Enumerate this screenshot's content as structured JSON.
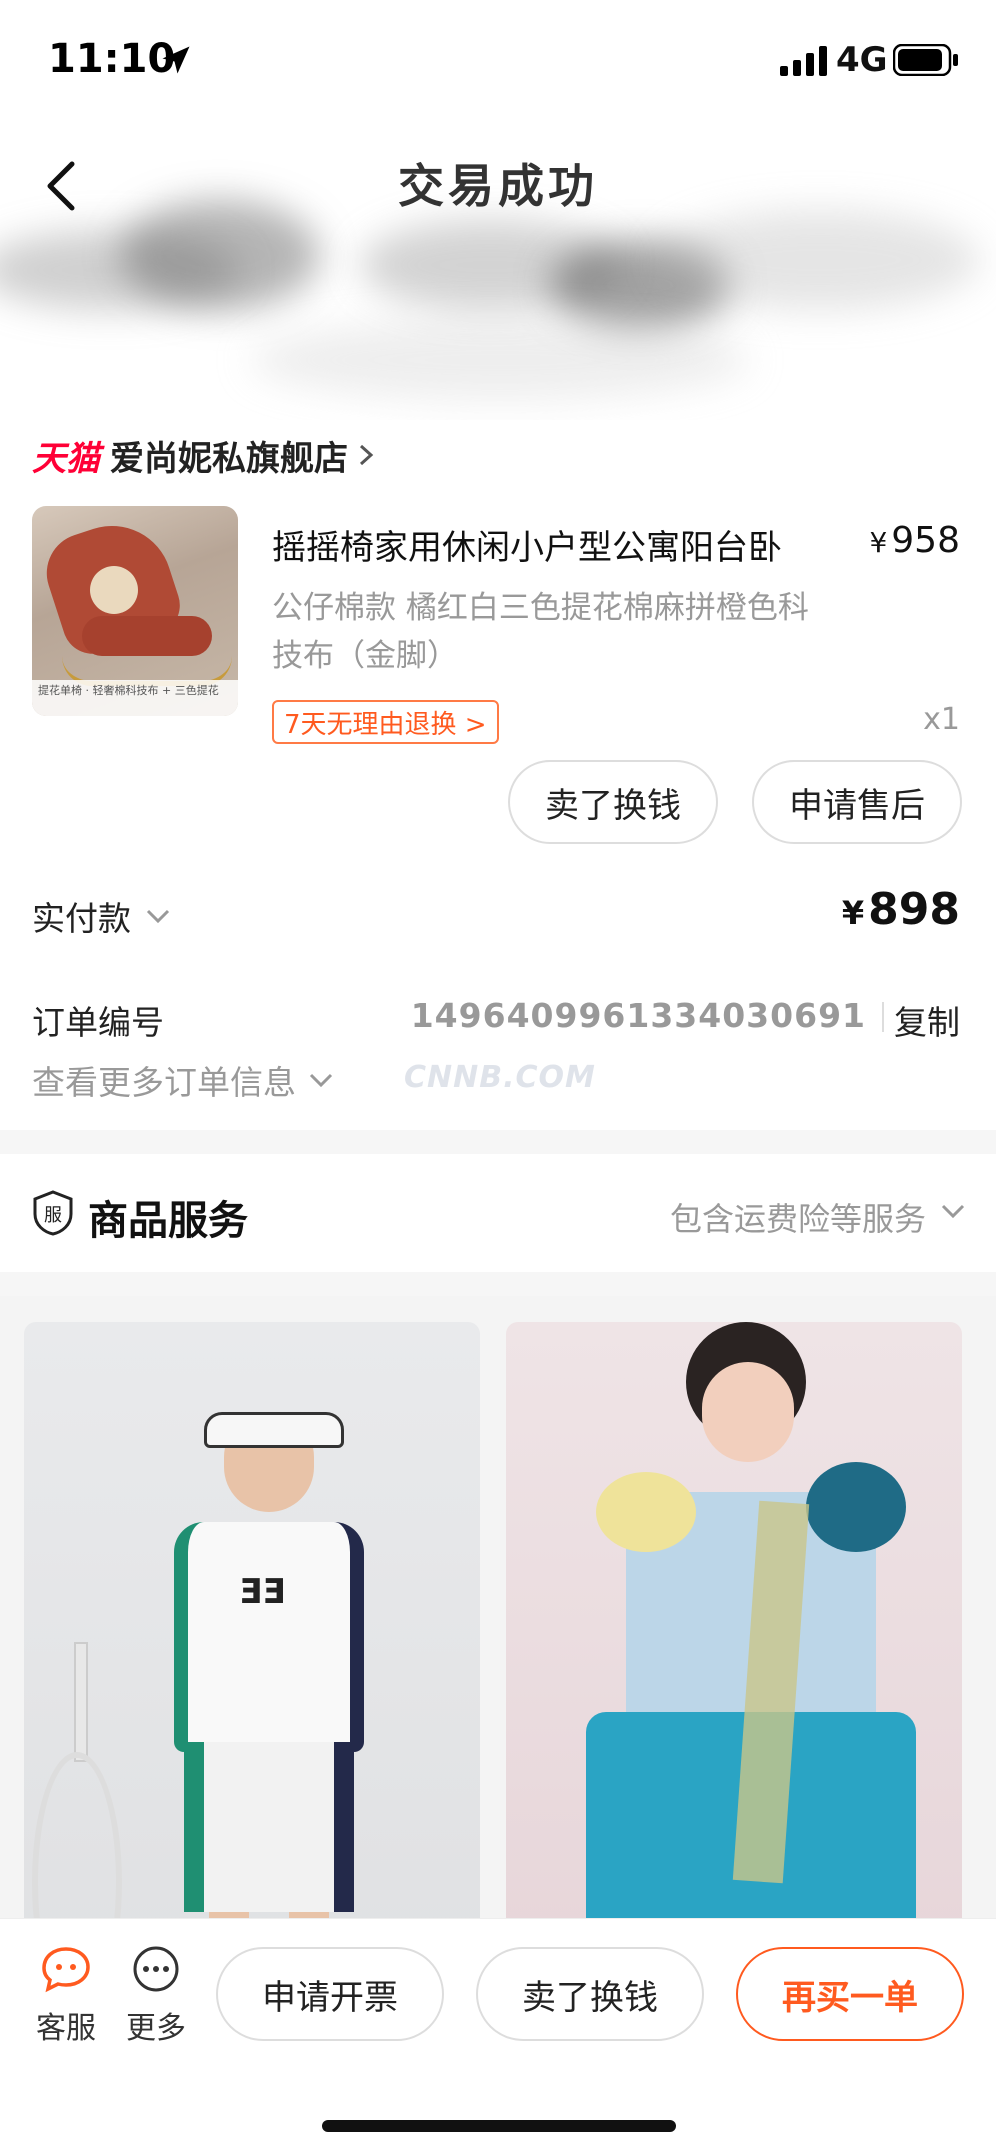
{
  "status": {
    "time": "11:10",
    "network": "4G"
  },
  "header": {
    "title": "交易成功"
  },
  "shop": {
    "platform": "天猫",
    "name": "爱尚妮私旗舰店"
  },
  "product": {
    "title": "摇摇椅家用休闲小户型公寓阳台卧",
    "price_symbol": "¥",
    "price": "958",
    "sku": "公仔棉款 橘红白三色提花棉麻拼橙色科技布（金脚）",
    "return_tag": "7天无理由退换 >",
    "quantity": "x1",
    "image_caption": "提花单椅 · 轻奢棉科技布 + 三色提花"
  },
  "actions": {
    "sell": "卖了换钱",
    "after_sale": "申请售后"
  },
  "payment": {
    "label": "实付款",
    "symbol": "¥",
    "amount": "898"
  },
  "order": {
    "label": "订单编号",
    "number": "1496409961334030691",
    "copy": "复制",
    "more": "查看更多订单信息",
    "watermark": "CNNB.COM"
  },
  "service": {
    "badge": "服",
    "title": "商品服务",
    "note": "包含运费险等服务"
  },
  "recommend": {
    "left_logo": "ƎƎ"
  },
  "bottom": {
    "kefu": "客服",
    "more": "更多",
    "invoice": "申请开票",
    "sell": "卖了换钱",
    "rebuy": "再买一单"
  },
  "colors": {
    "accent": "#ff5a1f",
    "tmall": "#ff0036",
    "muted": "#999999"
  }
}
